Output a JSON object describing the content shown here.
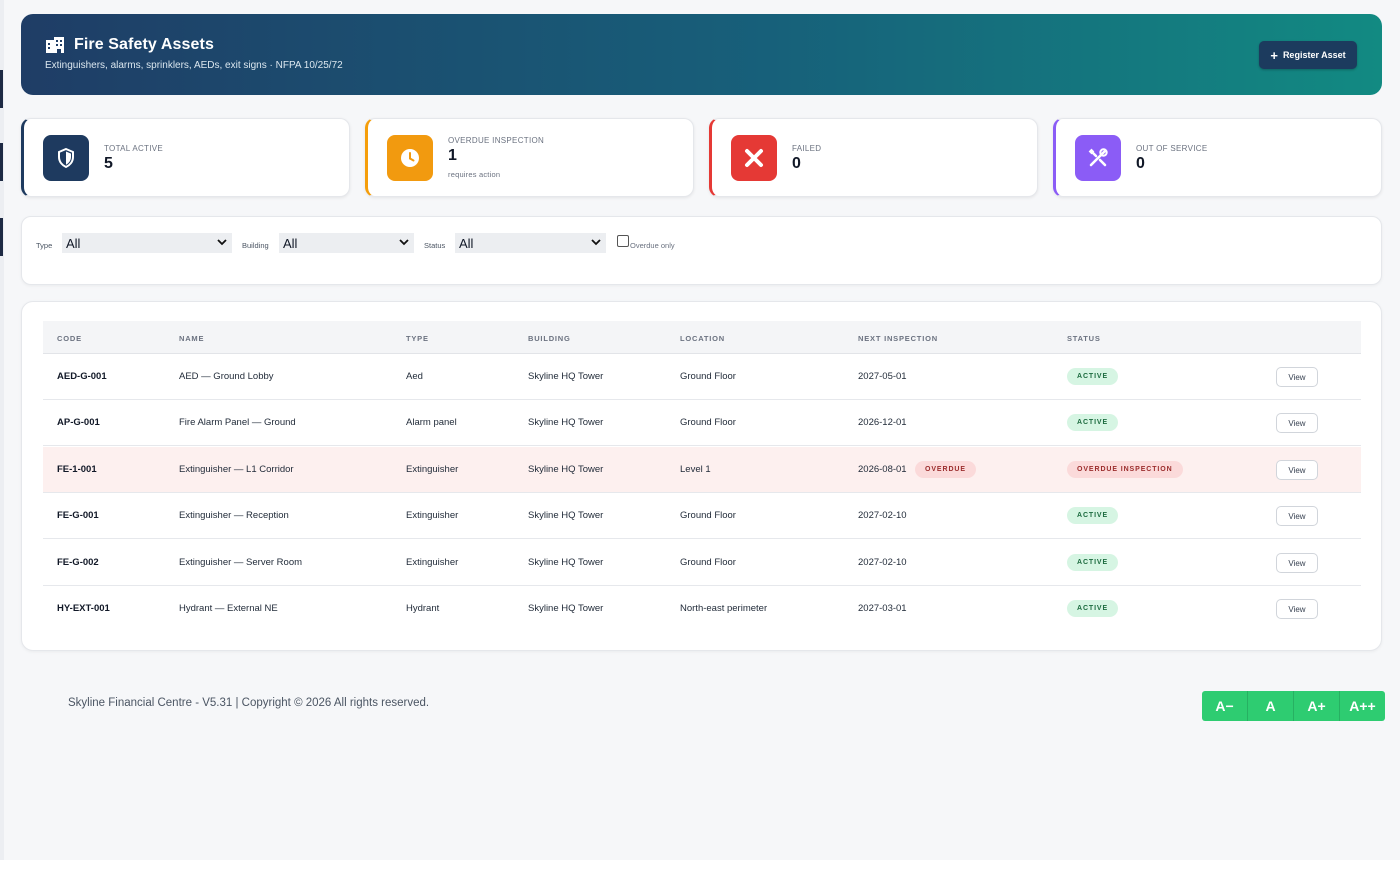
{
  "header": {
    "title": "Fire Safety Assets",
    "subtitle": "Extinguishers, alarms, sprinklers, AEDs, exit signs · NFPA 10/25/72",
    "register_label": "Register Asset"
  },
  "stats": [
    {
      "label": "TOTAL ACTIVE",
      "value": "5",
      "note": "",
      "color": "#1e3a5f",
      "icon": "shield-icon"
    },
    {
      "label": "OVERDUE INSPECTION",
      "value": "1",
      "note": "requires action",
      "color": "#f59e0b",
      "icon": "clock-icon"
    },
    {
      "label": "FAILED",
      "value": "0",
      "note": "",
      "color": "#e53935",
      "icon": "x-icon"
    },
    {
      "label": "OUT OF SERVICE",
      "value": "0",
      "note": "",
      "color": "#8b5cf6",
      "icon": "tools-icon"
    }
  ],
  "filters": {
    "type_label": "Type",
    "type_value": "All",
    "building_label": "Building",
    "building_value": "All",
    "status_label": "Status",
    "status_value": "All",
    "overdue_label": "Overdue only"
  },
  "table": {
    "headers": [
      "CODE",
      "NAME",
      "TYPE",
      "BUILDING",
      "LOCATION",
      "NEXT INSPECTION",
      "STATUS"
    ],
    "view_label": "View",
    "rows": [
      {
        "code": "AED-G-001",
        "name": "AED — Ground Lobby",
        "type": "Aed",
        "building": "Skyline HQ Tower",
        "location": "Ground Floor",
        "next": "2027-05-01",
        "overdue_tag": "",
        "status": "ACTIVE"
      },
      {
        "code": "AP-G-001",
        "name": "Fire Alarm Panel — Ground",
        "type": "Alarm panel",
        "building": "Skyline HQ Tower",
        "location": "Ground Floor",
        "next": "2026-12-01",
        "overdue_tag": "",
        "status": "ACTIVE"
      },
      {
        "code": "FE-1-001",
        "name": "Extinguisher — L1 Corridor",
        "type": "Extinguisher",
        "building": "Skyline HQ Tower",
        "location": "Level 1",
        "next": "2026-08-01",
        "overdue_tag": "OVERDUE",
        "status": "OVERDUE INSPECTION"
      },
      {
        "code": "FE-G-001",
        "name": "Extinguisher — Reception",
        "type": "Extinguisher",
        "building": "Skyline HQ Tower",
        "location": "Ground Floor",
        "next": "2027-02-10",
        "overdue_tag": "",
        "status": "ACTIVE"
      },
      {
        "code": "FE-G-002",
        "name": "Extinguisher — Server Room",
        "type": "Extinguisher",
        "building": "Skyline HQ Tower",
        "location": "Ground Floor",
        "next": "2027-02-10",
        "overdue_tag": "",
        "status": "ACTIVE"
      },
      {
        "code": "HY-EXT-001",
        "name": "Hydrant — External NE",
        "type": "Hydrant",
        "building": "Skyline HQ Tower",
        "location": "North-east perimeter",
        "next": "2027-03-01",
        "overdue_tag": "",
        "status": "ACTIVE"
      }
    ]
  },
  "footer": {
    "text": "Skyline Financial Centre - V5.31 | Copyright © 2026 All rights reserved.",
    "font_buttons": [
      "A−",
      "A",
      "A+",
      "A++"
    ]
  }
}
